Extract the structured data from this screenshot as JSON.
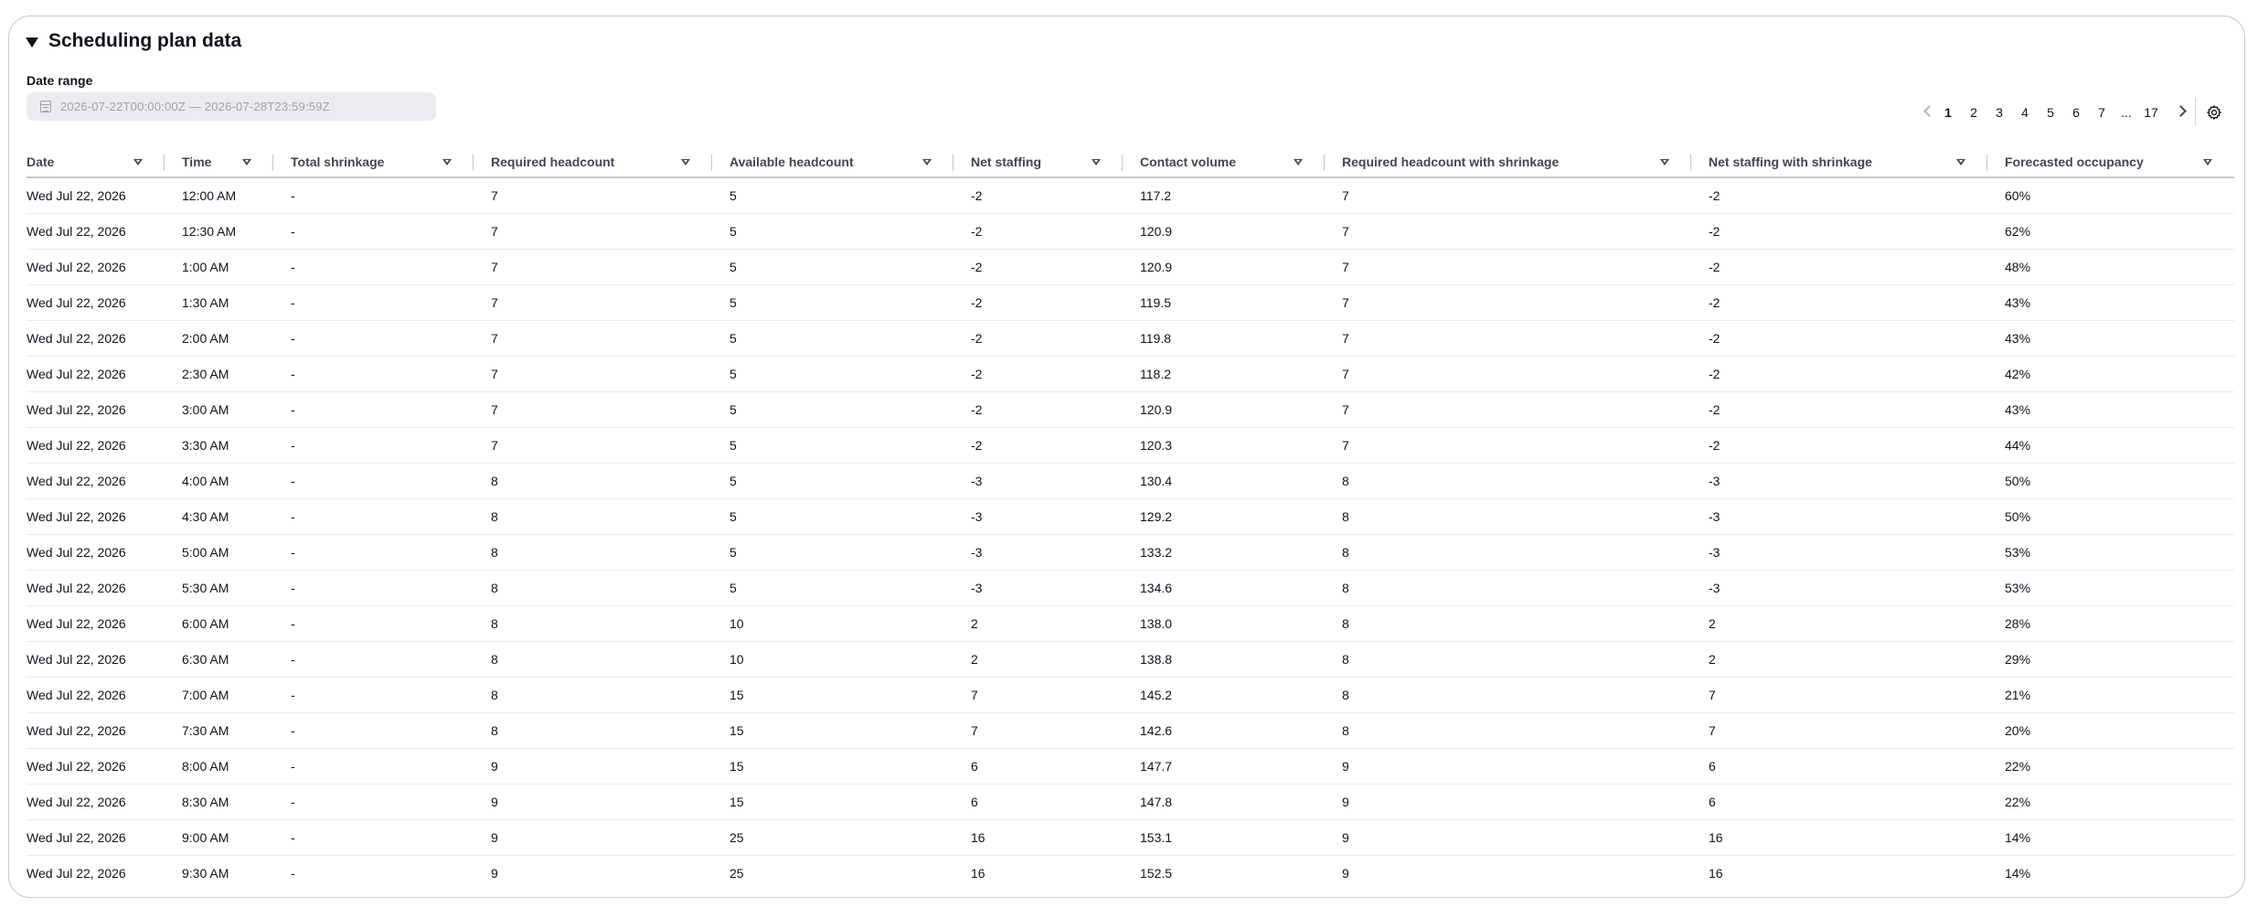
{
  "panel": {
    "title": "Scheduling plan data"
  },
  "date_range": {
    "label": "Date range",
    "value": "2026-07-22T00:00:00Z — 2026-07-28T23:59:59Z"
  },
  "pagination": {
    "pages": [
      "1",
      "2",
      "3",
      "4",
      "5",
      "6",
      "7",
      "...",
      "17"
    ],
    "current": "1"
  },
  "table": {
    "columns": [
      "Date",
      "Time",
      "Total shrinkage",
      "Required headcount",
      "Available headcount",
      "Net staffing",
      "Contact volume",
      "Required headcount with shrinkage",
      "Net staffing with shrinkage",
      "Forecasted occupancy"
    ],
    "rows": [
      [
        "Wed Jul 22, 2026",
        "12:00 AM",
        "-",
        "7",
        "5",
        "-2",
        "117.2",
        "7",
        "-2",
        "60%"
      ],
      [
        "Wed Jul 22, 2026",
        "12:30 AM",
        "-",
        "7",
        "5",
        "-2",
        "120.9",
        "7",
        "-2",
        "62%"
      ],
      [
        "Wed Jul 22, 2026",
        "1:00 AM",
        "-",
        "7",
        "5",
        "-2",
        "120.9",
        "7",
        "-2",
        "48%"
      ],
      [
        "Wed Jul 22, 2026",
        "1:30 AM",
        "-",
        "7",
        "5",
        "-2",
        "119.5",
        "7",
        "-2",
        "43%"
      ],
      [
        "Wed Jul 22, 2026",
        "2:00 AM",
        "-",
        "7",
        "5",
        "-2",
        "119.8",
        "7",
        "-2",
        "43%"
      ],
      [
        "Wed Jul 22, 2026",
        "2:30 AM",
        "-",
        "7",
        "5",
        "-2",
        "118.2",
        "7",
        "-2",
        "42%"
      ],
      [
        "Wed Jul 22, 2026",
        "3:00 AM",
        "-",
        "7",
        "5",
        "-2",
        "120.9",
        "7",
        "-2",
        "43%"
      ],
      [
        "Wed Jul 22, 2026",
        "3:30 AM",
        "-",
        "7",
        "5",
        "-2",
        "120.3",
        "7",
        "-2",
        "44%"
      ],
      [
        "Wed Jul 22, 2026",
        "4:00 AM",
        "-",
        "8",
        "5",
        "-3",
        "130.4",
        "8",
        "-3",
        "50%"
      ],
      [
        "Wed Jul 22, 2026",
        "4:30 AM",
        "-",
        "8",
        "5",
        "-3",
        "129.2",
        "8",
        "-3",
        "50%"
      ],
      [
        "Wed Jul 22, 2026",
        "5:00 AM",
        "-",
        "8",
        "5",
        "-3",
        "133.2",
        "8",
        "-3",
        "53%"
      ],
      [
        "Wed Jul 22, 2026",
        "5:30 AM",
        "-",
        "8",
        "5",
        "-3",
        "134.6",
        "8",
        "-3",
        "53%"
      ],
      [
        "Wed Jul 22, 2026",
        "6:00 AM",
        "-",
        "8",
        "10",
        "2",
        "138.0",
        "8",
        "2",
        "28%"
      ],
      [
        "Wed Jul 22, 2026",
        "6:30 AM",
        "-",
        "8",
        "10",
        "2",
        "138.8",
        "8",
        "2",
        "29%"
      ],
      [
        "Wed Jul 22, 2026",
        "7:00 AM",
        "-",
        "8",
        "15",
        "7",
        "145.2",
        "8",
        "7",
        "21%"
      ],
      [
        "Wed Jul 22, 2026",
        "7:30 AM",
        "-",
        "8",
        "15",
        "7",
        "142.6",
        "8",
        "7",
        "20%"
      ],
      [
        "Wed Jul 22, 2026",
        "8:00 AM",
        "-",
        "9",
        "15",
        "6",
        "147.7",
        "9",
        "6",
        "22%"
      ],
      [
        "Wed Jul 22, 2026",
        "8:30 AM",
        "-",
        "9",
        "15",
        "6",
        "147.8",
        "9",
        "6",
        "22%"
      ],
      [
        "Wed Jul 22, 2026",
        "9:00 AM",
        "-",
        "9",
        "25",
        "16",
        "153.1",
        "9",
        "16",
        "14%"
      ],
      [
        "Wed Jul 22, 2026",
        "9:30 AM",
        "-",
        "9",
        "25",
        "16",
        "152.5",
        "9",
        "16",
        "14%"
      ]
    ]
  },
  "icons": {
    "collapse": "caret-down-icon",
    "calendar": "calendar-icon",
    "sort": "sort-icon",
    "prev": "chevron-left-icon",
    "next": "chevron-right-icon",
    "settings": "gear-icon"
  },
  "colors": {
    "text": "#0f141a",
    "header_text": "#424650",
    "disabled_text": "#a0a0aa",
    "border": "#c6c6cd",
    "row_divider": "#e9ebed",
    "field_bg": "#ebebf0"
  }
}
